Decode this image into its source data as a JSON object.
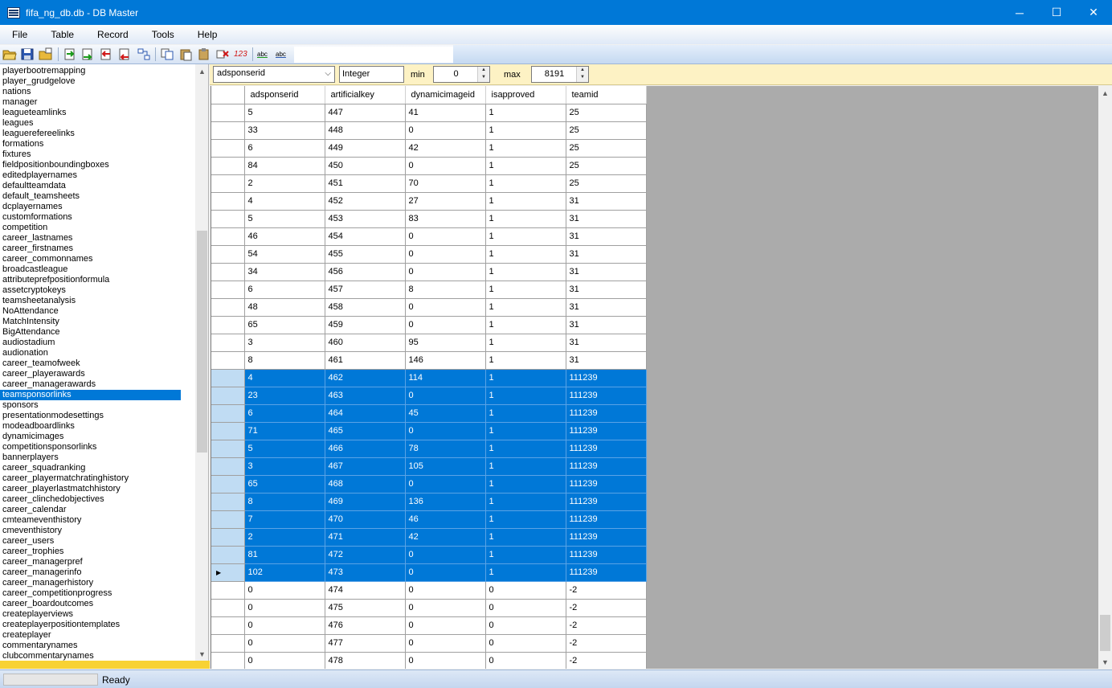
{
  "window": {
    "title": "fifa_ng_db.db - DB Master",
    "minimize": "─",
    "maximize": "☐",
    "close": "✕"
  },
  "menu": [
    "File",
    "Table",
    "Record",
    "Tools",
    "Help"
  ],
  "toolbar": {
    "buttons": [
      "open-folder-icon",
      "save-icon",
      "open-icon",
      "import-green-icon",
      "export-green-icon",
      "import-red-icon",
      "export-red-icon",
      "link-tables-icon",
      "copy-icon",
      "paste-icon",
      "paste-special-icon",
      "delete-record-icon",
      "numeric-icon",
      "spell-check-icon",
      "spell-check-2-icon"
    ],
    "numeric_label": "123",
    "abc_label": "abc"
  },
  "tables": [
    "playerbootremapping",
    "player_grudgelove",
    "nations",
    "manager",
    "leagueteamlinks",
    "leagues",
    "leaguerefereelinks",
    "formations",
    "fixtures",
    "fieldpositionboundingboxes",
    "editedplayernames",
    "defaultteamdata",
    "default_teamsheets",
    "dcplayernames",
    "customformations",
    "competition",
    "career_lastnames",
    "career_firstnames",
    "career_commonnames",
    "broadcastleague",
    "attributeprefpositionformula",
    "assetcryptokeys",
    "teamsheetanalysis",
    "NoAttendance",
    "MatchIntensity",
    "BigAttendance",
    "audiostadium",
    "audionation",
    "career_teamofweek",
    "career_playerawards",
    "career_managerawards",
    "teamsponsorlinks",
    "sponsors",
    "presentationmodesettings",
    "modeadboardlinks",
    "dynamicimages",
    "competitionsponsorlinks",
    "bannerplayers",
    "career_squadranking",
    "career_playermatchratinghistory",
    "career_playerlastmatchhistory",
    "career_clinchedobjectives",
    "career_calendar",
    "cmteameventhistory",
    "cmeventhistory",
    "career_users",
    "career_trophies",
    "career_managerpref",
    "career_managerinfo",
    "career_managerhistory",
    "career_competitionprogress",
    "career_boardoutcomes",
    "createplayerviews",
    "createplayerpositiontemplates",
    "createplayer",
    "commentarynames",
    "clubcommentarynames"
  ],
  "selected_table": "teamsponsorlinks",
  "filter": {
    "field": "adsponserid",
    "type": "Integer",
    "min_label": "min",
    "min_value": "0",
    "max_label": "max",
    "max_value": "8191"
  },
  "grid": {
    "columns": [
      "adsponserid",
      "artificialkey",
      "dynamicimageid",
      "isapproved",
      "teamid"
    ],
    "rows": [
      [
        "5",
        "447",
        "41",
        "1",
        "25"
      ],
      [
        "33",
        "448",
        "0",
        "1",
        "25"
      ],
      [
        "6",
        "449",
        "42",
        "1",
        "25"
      ],
      [
        "84",
        "450",
        "0",
        "1",
        "25"
      ],
      [
        "2",
        "451",
        "70",
        "1",
        "25"
      ],
      [
        "4",
        "452",
        "27",
        "1",
        "31"
      ],
      [
        "5",
        "453",
        "83",
        "1",
        "31"
      ],
      [
        "46",
        "454",
        "0",
        "1",
        "31"
      ],
      [
        "54",
        "455",
        "0",
        "1",
        "31"
      ],
      [
        "34",
        "456",
        "0",
        "1",
        "31"
      ],
      [
        "6",
        "457",
        "8",
        "1",
        "31"
      ],
      [
        "48",
        "458",
        "0",
        "1",
        "31"
      ],
      [
        "65",
        "459",
        "0",
        "1",
        "31"
      ],
      [
        "3",
        "460",
        "95",
        "1",
        "31"
      ],
      [
        "8",
        "461",
        "146",
        "1",
        "31"
      ],
      [
        "4",
        "462",
        "114",
        "1",
        "111239"
      ],
      [
        "23",
        "463",
        "0",
        "1",
        "111239"
      ],
      [
        "6",
        "464",
        "45",
        "1",
        "111239"
      ],
      [
        "71",
        "465",
        "0",
        "1",
        "111239"
      ],
      [
        "5",
        "466",
        "78",
        "1",
        "111239"
      ],
      [
        "3",
        "467",
        "105",
        "1",
        "111239"
      ],
      [
        "65",
        "468",
        "0",
        "1",
        "111239"
      ],
      [
        "8",
        "469",
        "136",
        "1",
        "111239"
      ],
      [
        "7",
        "470",
        "46",
        "1",
        "111239"
      ],
      [
        "2",
        "471",
        "42",
        "1",
        "111239"
      ],
      [
        "81",
        "472",
        "0",
        "1",
        "111239"
      ],
      [
        "102",
        "473",
        "0",
        "1",
        "111239"
      ],
      [
        "0",
        "474",
        "0",
        "0",
        "-2"
      ],
      [
        "0",
        "475",
        "0",
        "0",
        "-2"
      ],
      [
        "0",
        "476",
        "0",
        "0",
        "-2"
      ],
      [
        "0",
        "477",
        "0",
        "0",
        "-2"
      ],
      [
        "0",
        "478",
        "0",
        "0",
        "-2"
      ]
    ],
    "selected_rows": [
      15,
      16,
      17,
      18,
      19,
      20,
      21,
      22,
      23,
      24,
      25,
      26
    ],
    "current_row": 26,
    "current_marker": "▶"
  },
  "status": {
    "text": "Ready"
  },
  "colors": {
    "title_bar": "#0078d7",
    "selection": "#0078d7",
    "filter_bar": "#fdf2c4",
    "sidebar_footer": "#f8d234"
  }
}
